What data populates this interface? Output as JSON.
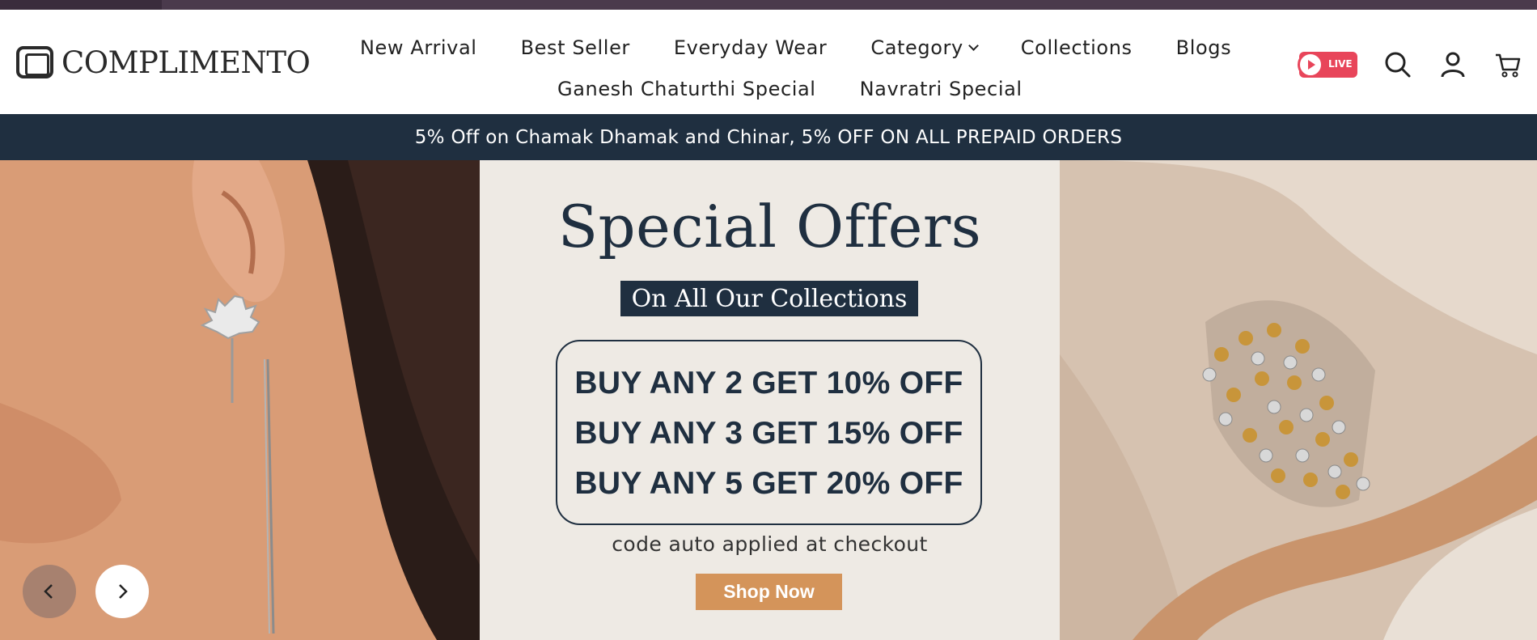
{
  "brand": {
    "name": "COMPLIMENTO",
    "icon": "logo-frame-icon"
  },
  "nav": {
    "row1": [
      {
        "label": "New Arrival"
      },
      {
        "label": "Best Seller"
      },
      {
        "label": "Everyday Wear"
      },
      {
        "label": "Category",
        "has_dropdown": true
      },
      {
        "label": "Collections"
      },
      {
        "label": "Blogs"
      }
    ],
    "row2": [
      {
        "label": "Ganesh Chaturthi Special"
      },
      {
        "label": "Navratri Special"
      }
    ]
  },
  "header_icons": {
    "live_label": "LIVE",
    "icons": [
      "play-icon",
      "search-icon",
      "account-icon",
      "cart-icon"
    ]
  },
  "announcement": {
    "text": "5% Off on Chamak Dhamak and Chinar, 5% OFF ON ALL PREPAID ORDERS"
  },
  "hero": {
    "title": "Special Offers",
    "subtitle": "On All Our Collections",
    "offers": [
      "BUY ANY 2 GET 10% OFF",
      "BUY ANY 3 GET 15% OFF",
      "BUY ANY 5 GET 20% OFF"
    ],
    "note": "code auto applied at checkout",
    "cta": "Shop Now"
  },
  "colors": {
    "navy": "#1f2f40",
    "cta": "#d4945a",
    "live": "#e8455a",
    "banner_bg": "#eeeae4"
  }
}
